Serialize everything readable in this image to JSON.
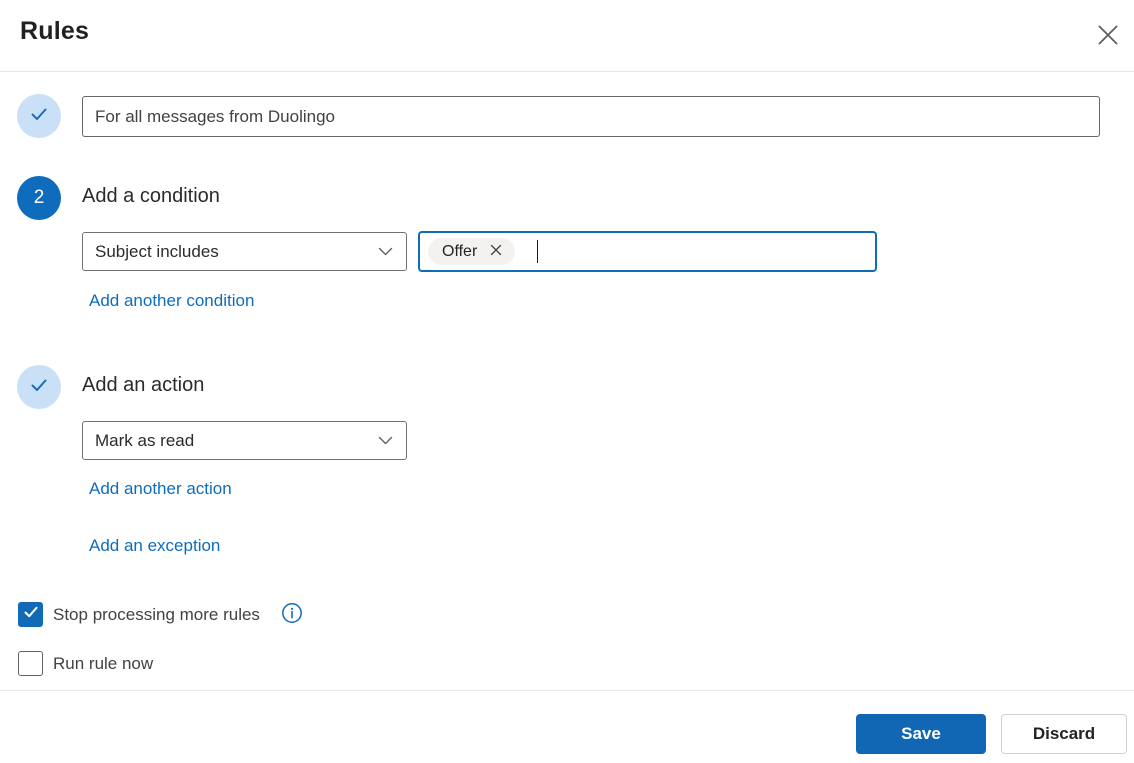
{
  "dialog": {
    "title": "Rules"
  },
  "rule": {
    "name_value": "For all messages from Duolingo",
    "condition": {
      "step_number": "2",
      "heading": "Add a condition",
      "selected_condition": "Subject includes",
      "value_chips": [
        "Offer"
      ],
      "add_another_label": "Add another condition"
    },
    "action": {
      "heading": "Add an action",
      "selected_action": "Mark as read",
      "add_another_label": "Add another action",
      "add_exception_label": "Add an exception"
    },
    "options": {
      "stop_processing": {
        "label": "Stop processing more rules",
        "checked": true
      },
      "run_rule_now": {
        "label": "Run rule now",
        "checked": false
      }
    }
  },
  "footer": {
    "save_label": "Save",
    "discard_label": "Discard"
  },
  "icons": {
    "close": "✕",
    "chip_dismiss": "✕",
    "chevron_down": "⌄",
    "checkmark": "✓",
    "info": "ⓘ"
  },
  "colors": {
    "primary_blue": "#0f6cbd",
    "solid_circle_blue": "#1267b4",
    "light_circle_blue": "#c9e0f7",
    "link_blue": "#0f6cbd",
    "focused_input_border": "#0f6cbd",
    "chip_background": "#f3f2f1",
    "divider": "#e6e6e6",
    "text_primary": "#242424",
    "text_secondary": "#424242"
  }
}
